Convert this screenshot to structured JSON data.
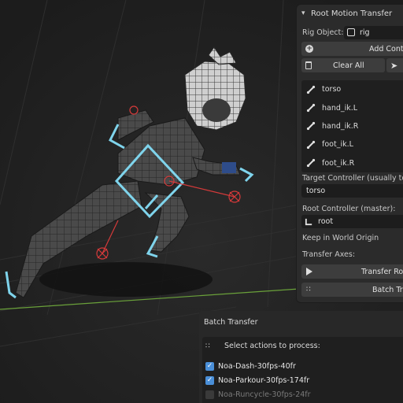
{
  "colors": {
    "panel_bg": "#2b2b2b",
    "field_bg": "#1d1d1d",
    "button_bg": "#3d3d3d",
    "checkbox_on": "#4a8fd8",
    "controller_cyan": "#7fd4ec",
    "controller_red": "#d43a3a",
    "ground_axis_green": "#6aa13a"
  },
  "panel": {
    "title": "Root Motion Transfer",
    "rig_object_label": "Rig Object:",
    "rig_object_value": "rig",
    "add_controller_label": "Add Controller",
    "clear_all_label": "Clear All",
    "controllers": [
      {
        "label": "torso",
        "icon": "bone-icon"
      },
      {
        "label": "hand_ik.L",
        "icon": "bone-icon"
      },
      {
        "label": "hand_ik.R",
        "icon": "bone-icon"
      },
      {
        "label": "foot_ik.L",
        "icon": "bone-icon"
      },
      {
        "label": "foot_ik.R",
        "icon": "bone-icon"
      }
    ],
    "target_controller_label": "Target Controller (usually torso)",
    "target_controller_value": "torso",
    "root_controller_label": "Root Controller (master):",
    "root_controller_value": "root",
    "keep_world_origin_label": "Keep in World Origin",
    "transfer_axes_label": "Transfer Axes:",
    "transfer_root_label": "Transfer Root Motion",
    "batch_transfer_label": "Batch Transfer"
  },
  "batch": {
    "title": "Batch Transfer",
    "select_label": "Select actions to process:",
    "actions": [
      {
        "name": "Noa-Dash-30fps-40fr",
        "checked": true
      },
      {
        "name": "Noa-Parkour-30fps-174fr",
        "checked": true
      },
      {
        "name": "Noa-Runcycle-30fps-24fr",
        "checked": false
      }
    ]
  }
}
